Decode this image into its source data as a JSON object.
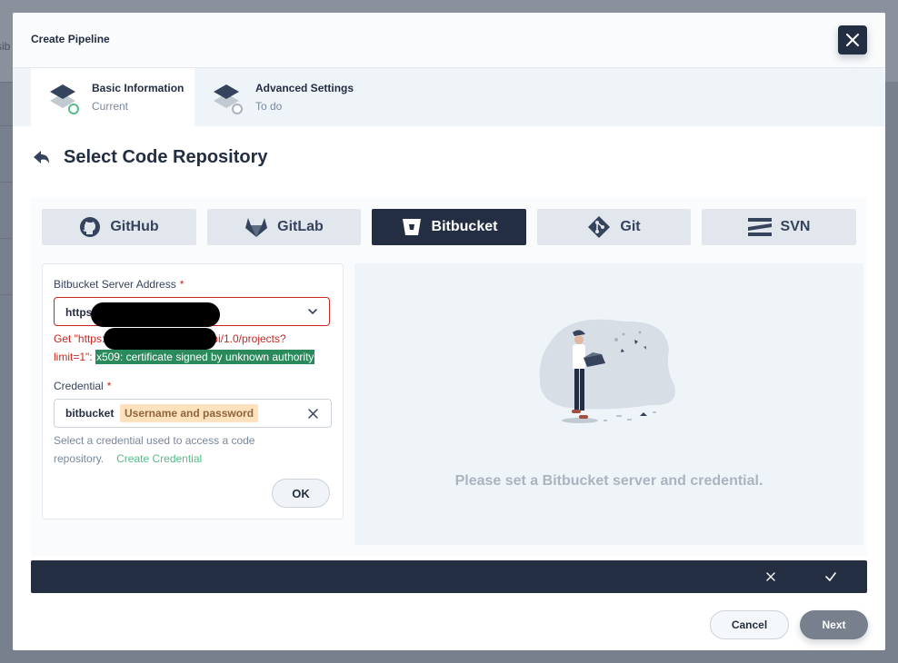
{
  "background": {
    "partial_text": "sib"
  },
  "modal": {
    "title": "Create Pipeline"
  },
  "steps": [
    {
      "title": "Basic Information",
      "status": "Current"
    },
    {
      "title": "Advanced Settings",
      "status": "To do"
    }
  ],
  "section": {
    "title": "Select Code Repository"
  },
  "tabs": [
    {
      "label": "GitHub",
      "icon": "github-icon"
    },
    {
      "label": "GitLab",
      "icon": "gitlab-icon"
    },
    {
      "label": "Bitbucket",
      "icon": "bitbucket-icon",
      "selected": true
    },
    {
      "label": "Git",
      "icon": "git-icon"
    },
    {
      "label": "SVN",
      "icon": "svn-icon"
    }
  ],
  "form": {
    "server_label": "Bitbucket Server Address",
    "server_value": "https",
    "error_line1_prefix": "Get \"https:",
    "error_line1_suffix": "rest/api/1.0/projects?",
    "error_line2_prefix": "limit=1\": ",
    "error_line2_highlight": "x509: certificate signed by unknown authority",
    "credential_label": "Credential",
    "credential_value": "bitbucket",
    "credential_type": "Username and password",
    "help_line1": "Select a credential used to access a code",
    "help_line2": "repository.",
    "create_link": "Create Credential",
    "ok_label": "OK"
  },
  "preview": {
    "message": "Please set a Bitbucket server and credential."
  },
  "footer": {
    "cancel_label": "Cancel",
    "next_label": "Next"
  },
  "colors": {
    "dark": "#242e42",
    "error": "#ca2621",
    "success": "#55bc8a",
    "highlight": "#2b8a5b"
  }
}
